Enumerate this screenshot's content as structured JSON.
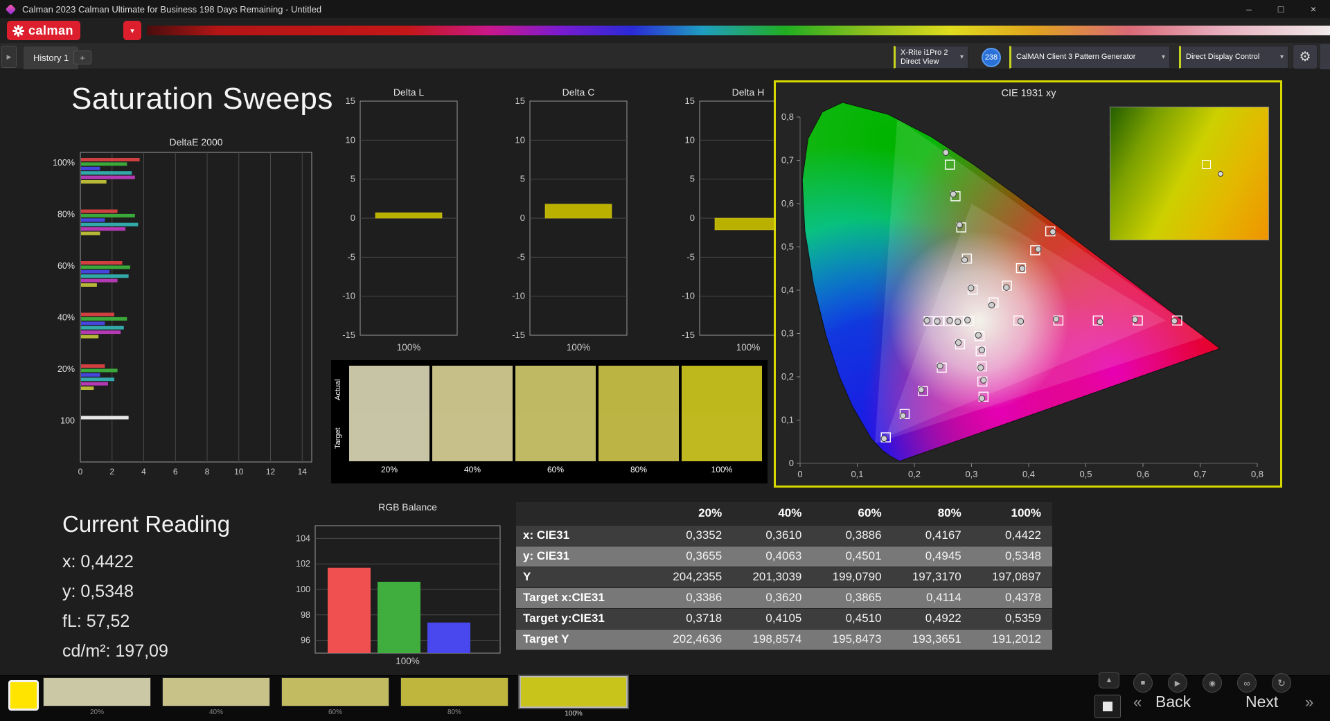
{
  "window": {
    "title": "Calman 2023 Calman Ultimate for Business 198 Days Remaining - Untitled"
  },
  "icons": {
    "chevron_down": "▾",
    "gear": "⚙",
    "plus": "+",
    "tab_scroll": "▶",
    "eject": "▲",
    "stop": "■",
    "play": "▶",
    "record": "◉",
    "link": "∞",
    "refresh": "↻",
    "back_chevrons": "«",
    "next_chevrons": "»",
    "minimize": "–",
    "maximize": "□",
    "close": "×"
  },
  "brand": {
    "logo_text": "calman"
  },
  "tabs": {
    "history_tab": "History 1",
    "add_tab": "+"
  },
  "devices": {
    "meter_line1": "X-Rite i1Pro 2",
    "meter_line2": "Direct View",
    "badge": "238",
    "pattern_generator": "CalMAN Client 3 Pattern Generator",
    "display_control": "Direct Display Control"
  },
  "page": {
    "title": "Saturation Sweeps"
  },
  "current_reading": {
    "title": "Current Reading",
    "lines": [
      "x: 0,4422",
      "y: 0,5348",
      "fL: 57,52",
      "cd/m²: 197,09"
    ]
  },
  "swatch_panel": {
    "row_labels": [
      "Actual",
      "Target"
    ],
    "columns": [
      {
        "label": "20%",
        "actual": "#c7c4a5",
        "target": "#c8c5a7"
      },
      {
        "label": "40%",
        "actual": "#c6bf88",
        "target": "#c7c08a"
      },
      {
        "label": "60%",
        "actual": "#c0b963",
        "target": "#c1ba65"
      },
      {
        "label": "80%",
        "actual": "#bbb342",
        "target": "#bcb444"
      },
      {
        "label": "100%",
        "actual": "#bfb81d",
        "target": "#c0b920"
      }
    ]
  },
  "table": {
    "header": [
      "",
      "20%",
      "40%",
      "60%",
      "80%",
      "100%"
    ],
    "rows": [
      {
        "label": "x: CIE31",
        "values": [
          "0,3352",
          "0,3610",
          "0,3886",
          "0,4167",
          "0,4422"
        ]
      },
      {
        "label": "y: CIE31",
        "values": [
          "0,3655",
          "0,4063",
          "0,4501",
          "0,4945",
          "0,5348"
        ]
      },
      {
        "label": "Y",
        "values": [
          "204,2355",
          "201,3039",
          "199,0790",
          "197,3170",
          "197,0897"
        ]
      },
      {
        "label": "Target x:CIE31",
        "values": [
          "0,3386",
          "0,3620",
          "0,3865",
          "0,4114",
          "0,4378"
        ]
      },
      {
        "label": "Target y:CIE31",
        "values": [
          "0,3718",
          "0,4105",
          "0,4510",
          "0,4922",
          "0,5359"
        ]
      },
      {
        "label": "Target Y",
        "values": [
          "202,4636",
          "198,8574",
          "195,8473",
          "193,3651",
          "191,2012"
        ]
      }
    ]
  },
  "bottom_bar": {
    "color_chip": "#ffe400",
    "patches": [
      {
        "label": "20%",
        "color": "#cbc8a5",
        "selected": false
      },
      {
        "label": "40%",
        "color": "#c9c288",
        "selected": false
      },
      {
        "label": "60%",
        "color": "#c3bb61",
        "selected": false
      },
      {
        "label": "80%",
        "color": "#bfb63e",
        "selected": false
      },
      {
        "label": "100%",
        "color": "#c9c41c",
        "selected": true
      }
    ],
    "buttons": {
      "back": "Back",
      "next": "Next"
    }
  },
  "chart_data": [
    {
      "id": "deltae2000",
      "type": "bar",
      "orientation": "horizontal",
      "title": "DeltaE 2000",
      "xticks": [
        0,
        2,
        4,
        6,
        8,
        10,
        12,
        14
      ],
      "xlim": [
        0,
        14.6
      ],
      "groups": [
        {
          "label": "100%",
          "values": [
            3.7,
            2.9,
            1.2,
            3.2,
            3.4,
            1.6
          ]
        },
        {
          "label": "80%",
          "values": [
            2.3,
            3.4,
            1.5,
            3.6,
            2.8,
            1.2
          ]
        },
        {
          "label": "60%",
          "values": [
            2.6,
            3.1,
            1.8,
            3.0,
            2.3,
            1.0
          ]
        },
        {
          "label": "40%",
          "values": [
            2.1,
            2.9,
            1.5,
            2.7,
            2.5,
            1.1
          ]
        },
        {
          "label": "20%",
          "values": [
            1.5,
            2.3,
            1.2,
            2.1,
            1.7,
            0.8
          ]
        },
        {
          "label": "100",
          "values": [
            3.0
          ]
        }
      ],
      "series_colors": [
        "#d04040",
        "#3aa83a",
        "#4646dc",
        "#32aaaa",
        "#b43ab4",
        "#b8b838"
      ],
      "single_color": "#e8e8e8"
    },
    {
      "id": "delta_l",
      "type": "bar",
      "title": "Delta L",
      "value": 0.7,
      "ylim": [
        -15,
        15
      ],
      "yticks": [
        15,
        10,
        5,
        0,
        -5,
        -10,
        -15
      ],
      "xlabel": "100%",
      "color": "#b9b000"
    },
    {
      "id": "delta_c",
      "type": "bar",
      "title": "Delta C",
      "value": 1.8,
      "ylim": [
        -15,
        15
      ],
      "yticks": [
        15,
        10,
        5,
        0,
        -5,
        -10,
        -15
      ],
      "xlabel": "100%",
      "color": "#b9b000"
    },
    {
      "id": "delta_h",
      "type": "bar",
      "title": "Delta H",
      "value": -1.5,
      "ylim": [
        -15,
        15
      ],
      "yticks": [
        15,
        10,
        5,
        0,
        -5,
        -10,
        -15
      ],
      "xlabel": "100%",
      "color": "#b9b000"
    },
    {
      "id": "rgb_balance",
      "type": "bar",
      "title": "RGB Balance",
      "categories": [
        "Red",
        "Green",
        "Blue"
      ],
      "values": [
        101.7,
        100.6,
        97.4
      ],
      "colors": [
        "#f05050",
        "#3fae3f",
        "#4848ee"
      ],
      "yticks": [
        104,
        102,
        100,
        98,
        96
      ],
      "ylim": [
        95,
        105
      ],
      "xlabel": "100%"
    },
    {
      "id": "cie1931",
      "type": "scatter",
      "title": "CIE 1931 xy",
      "xlim": [
        0,
        0.8
      ],
      "ylim": [
        0,
        0.8
      ],
      "xticks": [
        "0",
        "0,1",
        "0,2",
        "0,3",
        "0,4",
        "0,5",
        "0,6",
        "0,7",
        "0,8"
      ],
      "yticks": [
        "0",
        "0,1",
        "0,2",
        "0,3",
        "0,4",
        "0,5",
        "0,6",
        "0,7",
        "0,8"
      ],
      "sweeps": [
        {
          "name": "red",
          "targets": [
            [
              0.382,
              0.33
            ],
            [
              0.452,
              0.33
            ],
            [
              0.521,
              0.33
            ],
            [
              0.591,
              0.33
            ],
            [
              0.66,
              0.33
            ]
          ],
          "measured": [
            [
              0.386,
              0.328
            ],
            [
              0.448,
              0.333
            ],
            [
              0.525,
              0.327
            ],
            [
              0.586,
              0.332
            ],
            [
              0.655,
              0.329
            ]
          ]
        },
        {
          "name": "green",
          "targets": [
            [
              0.302,
              0.401
            ],
            [
              0.292,
              0.473
            ],
            [
              0.282,
              0.545
            ],
            [
              0.272,
              0.617
            ],
            [
              0.262,
              0.69
            ]
          ],
          "measured": [
            [
              0.299,
              0.405
            ],
            [
              0.288,
              0.47
            ],
            [
              0.279,
              0.551
            ],
            [
              0.268,
              0.622
            ],
            [
              0.255,
              0.718
            ]
          ]
        },
        {
          "name": "blue",
          "targets": [
            [
              0.28,
              0.275
            ],
            [
              0.248,
              0.221
            ],
            [
              0.215,
              0.167
            ],
            [
              0.183,
              0.114
            ],
            [
              0.15,
              0.06
            ]
          ],
          "measured": [
            [
              0.277,
              0.279
            ],
            [
              0.245,
              0.225
            ],
            [
              0.212,
              0.17
            ],
            [
              0.18,
              0.11
            ],
            [
              0.147,
              0.057
            ]
          ]
        },
        {
          "name": "cyan",
          "targets": [
            [
              0.295,
              0.329
            ],
            [
              0.278,
              0.329
            ],
            [
              0.26,
              0.329
            ],
            [
              0.243,
              0.329
            ],
            [
              0.225,
              0.329
            ]
          ],
          "measured": [
            [
              0.293,
              0.331
            ],
            [
              0.276,
              0.327
            ],
            [
              0.262,
              0.33
            ],
            [
              0.24,
              0.328
            ],
            [
              0.222,
              0.33
            ]
          ]
        },
        {
          "name": "magenta",
          "targets": [
            [
              0.314,
              0.294
            ],
            [
              0.316,
              0.259
            ],
            [
              0.318,
              0.224
            ],
            [
              0.319,
              0.189
            ],
            [
              0.321,
              0.154
            ]
          ],
          "measured": [
            [
              0.312,
              0.296
            ],
            [
              0.318,
              0.262
            ],
            [
              0.316,
              0.221
            ],
            [
              0.321,
              0.192
            ],
            [
              0.318,
              0.15
            ]
          ]
        },
        {
          "name": "yellow",
          "targets": [
            [
              0.3386,
              0.3718
            ],
            [
              0.362,
              0.4105
            ],
            [
              0.3865,
              0.451
            ],
            [
              0.4114,
              0.4922
            ],
            [
              0.4378,
              0.5359
            ]
          ],
          "measured": [
            [
              0.3352,
              0.3655
            ],
            [
              0.361,
              0.4063
            ],
            [
              0.3886,
              0.4501
            ],
            [
              0.4167,
              0.4945
            ],
            [
              0.4422,
              0.5348
            ]
          ]
        }
      ]
    }
  ]
}
